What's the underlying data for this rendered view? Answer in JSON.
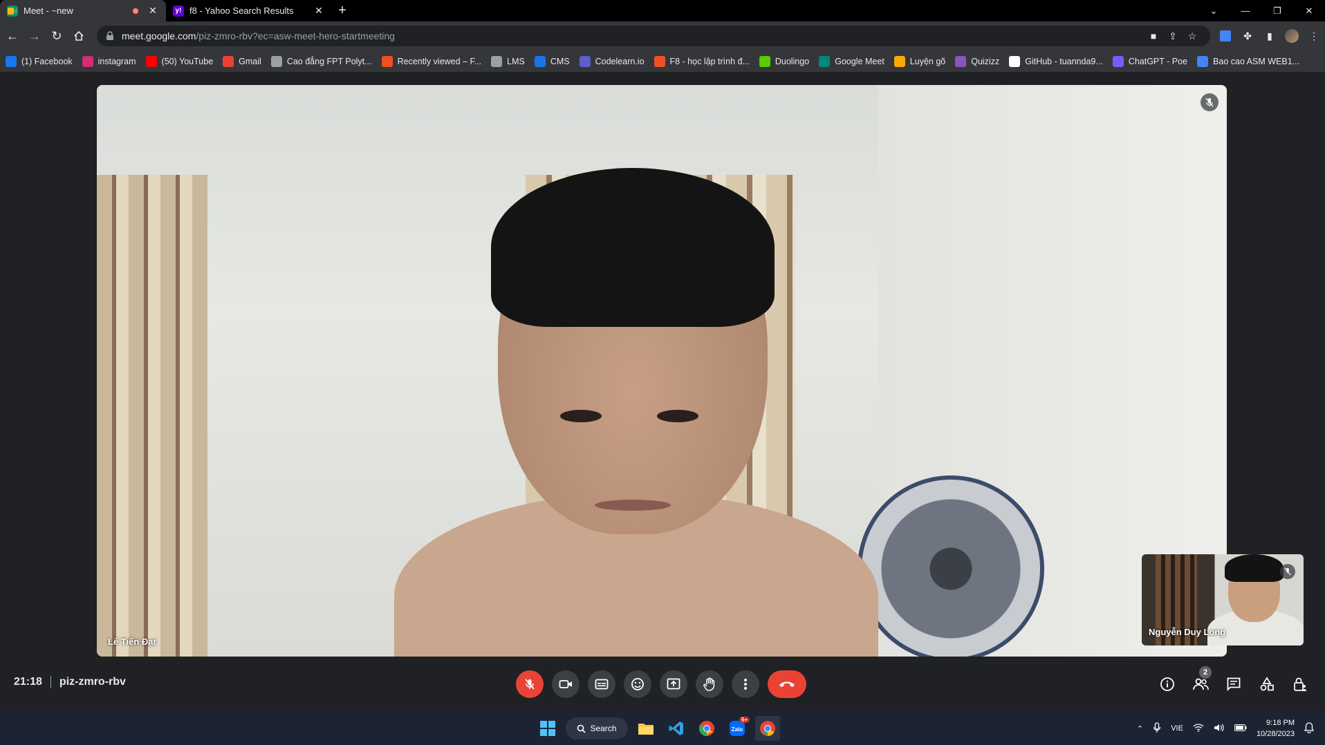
{
  "tabs": [
    {
      "title": "Meet - ~new",
      "favicon": "google-meet-icon",
      "recording": true,
      "active": true
    },
    {
      "title": "f8 - Yahoo Search Results",
      "favicon": "yahoo-icon",
      "recording": false,
      "active": false
    }
  ],
  "omnibox": {
    "host": "meet.google.com",
    "path": "/piz-zmro-rbv?ec=asw-meet-hero-startmeeting"
  },
  "bookmarks": [
    {
      "label": "(1) Facebook",
      "icon": "facebook-icon",
      "color": "#1877f2"
    },
    {
      "label": "instagram",
      "icon": "instagram-icon",
      "color": "#d62976"
    },
    {
      "label": "(50) YouTube",
      "icon": "youtube-icon",
      "color": "#ff0000"
    },
    {
      "label": "Gmail",
      "icon": "gmail-icon",
      "color": "#ea4335"
    },
    {
      "label": "Cao đẳng FPT Polyt...",
      "icon": "cloud-icon",
      "color": "#9aa0a6"
    },
    {
      "label": "Recently viewed – F...",
      "icon": "figma-icon",
      "color": "#f24e1e"
    },
    {
      "label": "LMS",
      "icon": "cloud-icon",
      "color": "#9aa0a6"
    },
    {
      "label": "CMS",
      "icon": "circle-icon",
      "color": "#1a73e8"
    },
    {
      "label": "Codelearn.io",
      "icon": "codelearn-icon",
      "color": "#5b5fc7"
    },
    {
      "label": "F8 - học lập trình đ...",
      "icon": "f8-icon",
      "color": "#f05123"
    },
    {
      "label": "Duolingo",
      "icon": "duolingo-icon",
      "color": "#58cc02"
    },
    {
      "label": "Google Meet",
      "icon": "google-meet-icon",
      "color": "#00897b"
    },
    {
      "label": "Luyện gõ",
      "icon": "keyboard-icon",
      "color": "#f9ab00"
    },
    {
      "label": "Quizizz",
      "icon": "quizizz-icon",
      "color": "#8854c0"
    },
    {
      "label": "GitHub - tuannda9...",
      "icon": "github-icon",
      "color": "#ffffff"
    },
    {
      "label": "ChatGPT - Poe",
      "icon": "poe-icon",
      "color": "#7b5bff"
    },
    {
      "label": "Bao cao ASM WEB1...",
      "icon": "docs-icon",
      "color": "#4285f4"
    }
  ],
  "meet": {
    "main_participant": "Lê Tiến Đạt",
    "pip_participant": "Nguyễn Duy Long",
    "time": "21:18",
    "meeting_code": "piz-zmro-rbv",
    "people_count": "2"
  },
  "taskbar": {
    "search_label": "Search",
    "teams_badge": "5+",
    "language": "VIE",
    "time": "9:18 PM",
    "date": "10/28/2023"
  },
  "colors": {
    "end_call": "#ea4335",
    "control_bg": "#3c4043",
    "page_bg": "#202124"
  }
}
